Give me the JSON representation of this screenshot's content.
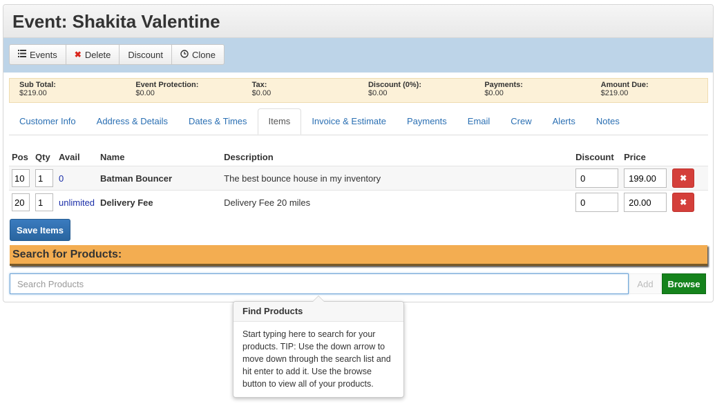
{
  "header": {
    "title": "Event: Shakita Valentine"
  },
  "toolbar": {
    "events_label": "Events",
    "delete_label": "Delete",
    "discount_label": "Discount",
    "clone_label": "Clone"
  },
  "summary": [
    {
      "label": "Sub Total:",
      "value": "$219.00"
    },
    {
      "label": "Event Protection:",
      "value": "$0.00"
    },
    {
      "label": "Tax:",
      "value": "$0.00"
    },
    {
      "label": "Discount (0%):",
      "value": "$0.00"
    },
    {
      "label": "Payments:",
      "value": "$0.00"
    },
    {
      "label": "Amount Due:",
      "value": "$219.00"
    }
  ],
  "tabs": [
    {
      "label": "Customer Info"
    },
    {
      "label": "Address & Details"
    },
    {
      "label": "Dates & Times"
    },
    {
      "label": "Items",
      "active": true
    },
    {
      "label": "Invoice & Estimate"
    },
    {
      "label": "Payments"
    },
    {
      "label": "Email"
    },
    {
      "label": "Crew"
    },
    {
      "label": "Alerts"
    },
    {
      "label": "Notes"
    }
  ],
  "items_table": {
    "headers": {
      "pos": "Pos",
      "qty": "Qty",
      "avail": "Avail",
      "name": "Name",
      "description": "Description",
      "discount": "Discount",
      "price": "Price"
    },
    "rows": [
      {
        "pos": "10",
        "qty": "1",
        "avail": "0",
        "name": "Batman Bouncer",
        "description": "The best bounce house in my inventory",
        "discount": "0",
        "price": "199.00"
      },
      {
        "pos": "20",
        "qty": "1",
        "avail": "unlimited",
        "name": "Delivery Fee",
        "description": "Delivery Fee 20 miles",
        "discount": "0",
        "price": "20.00"
      }
    ]
  },
  "save_label": "Save Items",
  "search": {
    "title": "Search for Products:",
    "placeholder": "Search Products",
    "add_label": "Add",
    "browse_label": "Browse"
  },
  "popover": {
    "title": "Find Products",
    "body": "Start typing here to search for your products. TIP: Use the down arrow to move down through the search list and hit enter to add it. Use the browse button to view all of your products."
  },
  "colors": {
    "toolbar_bg": "#bdd4e8",
    "summary_bg": "#fcf1d8",
    "search_title_bg": "#f3ad51",
    "browse_bg": "#15831c",
    "save_bg": "#2a659f",
    "delete_bg": "#d43f3a",
    "link": "#2a6fb3"
  }
}
